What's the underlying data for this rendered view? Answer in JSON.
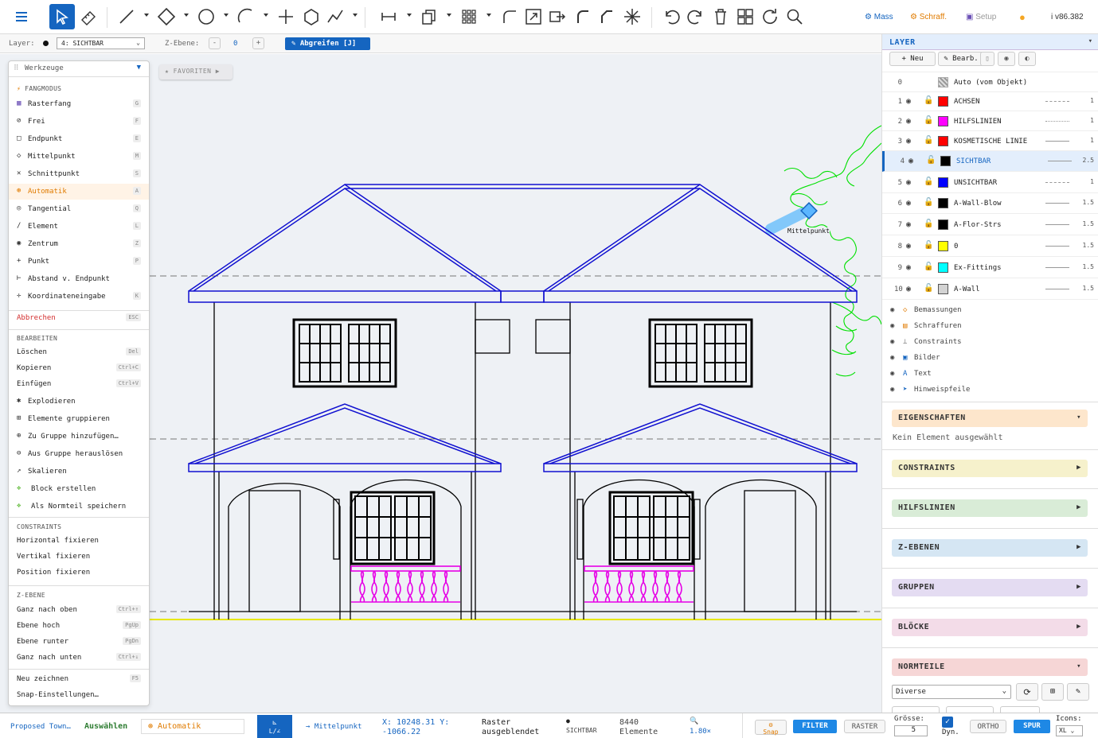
{
  "toolbar": {
    "right": {
      "mass": "Mass",
      "schraff": "Schraff.",
      "setup": "Setup",
      "version": "i v86.382"
    },
    "icons": [
      "menu-icon",
      "select-icon",
      "measure-icon",
      "line-icon",
      "rect-icon",
      "circle-icon",
      "arc-icon",
      "point-icon",
      "polygon-icon",
      "polyline-icon",
      "dimension-icon",
      "copy-icon",
      "array-icon",
      "fillet-icon",
      "scale-icon",
      "move-icon",
      "arc2-icon",
      "chamfer-icon",
      "explode-icon",
      "undo-icon",
      "redo-icon",
      "delete-icon",
      "grid-icon",
      "refresh-icon",
      "search-icon"
    ]
  },
  "layerbar": {
    "layer_label": "Layer:",
    "layer_value": "4: SICHTBAR",
    "z_label": "Z-Ebene:",
    "z_minus": "-",
    "z_value": "0",
    "z_plus": "+",
    "grab": "Abgreifen [J]"
  },
  "canvas": {
    "favorites": "★ FAVORITEN ▶",
    "snap_tooltip": "Mittelpunkt"
  },
  "tools": {
    "title": "Werkzeuge",
    "snap_header": "FANGMODUS",
    "snap": [
      {
        "label": "Rasterfang",
        "key": "G"
      },
      {
        "label": "Frei",
        "key": "F"
      },
      {
        "label": "Endpunkt",
        "key": "E"
      },
      {
        "label": "Mittelpunkt",
        "key": "M"
      },
      {
        "label": "Schnittpunkt",
        "key": "S"
      },
      {
        "label": "Automatik",
        "key": "A"
      },
      {
        "label": "Tangential",
        "key": "Q"
      },
      {
        "label": "Element",
        "key": "L"
      },
      {
        "label": "Zentrum",
        "key": "Z"
      },
      {
        "label": "Punkt",
        "key": "P"
      },
      {
        "label": "Abstand v. Endpunkt",
        "key": ""
      },
      {
        "label": "Koordinateneingabe",
        "key": "K"
      }
    ],
    "cancel": {
      "label": "Abbrechen",
      "key": "ESC"
    },
    "edit_header": "BEARBEITEN",
    "edit": [
      {
        "label": "Löschen",
        "key": "Del"
      },
      {
        "label": "Kopieren",
        "key": "Ctrl+C"
      },
      {
        "label": "Einfügen",
        "key": "Ctrl+V"
      },
      {
        "label": "Explodieren",
        "key": ""
      },
      {
        "label": "Elemente gruppieren",
        "key": ""
      },
      {
        "label": "Zu Gruppe hinzufügen…",
        "key": ""
      },
      {
        "label": "Aus Gruppe herauslösen",
        "key": ""
      },
      {
        "label": "Skalieren",
        "key": ""
      },
      {
        "label": "Block erstellen",
        "key": ""
      },
      {
        "label": "Als Normteil speichern",
        "key": ""
      }
    ],
    "constraints_header": "CONSTRAINTS",
    "constraints": [
      {
        "label": "Horizontal fixieren"
      },
      {
        "label": "Vertikal fixieren"
      },
      {
        "label": "Position fixieren"
      }
    ],
    "z_header": "Z-EBENE",
    "z": [
      {
        "label": "Ganz nach oben",
        "key": "Ctrl+↑"
      },
      {
        "label": "Ebene hoch",
        "key": "PgUp"
      },
      {
        "label": "Ebene runter",
        "key": "PgDn"
      },
      {
        "label": "Ganz nach unten",
        "key": "Ctrl+↓"
      }
    ],
    "redraw": {
      "label": "Neu zeichnen",
      "key": "F5"
    },
    "snap_settings": "Snap-Einstellungen…"
  },
  "layers": {
    "title": "LAYER",
    "btn_new": "+ Neu",
    "btn_edit": "✎ Bearb.",
    "auto": {
      "num": "0",
      "name": "Auto (vom Objekt)"
    },
    "rows": [
      {
        "num": "1",
        "name": "ACHSEN",
        "color": "#ff0000",
        "w": "1"
      },
      {
        "num": "2",
        "name": "HILFSLINIEN",
        "color": "#ff00ff",
        "w": "1"
      },
      {
        "num": "3",
        "name": "KOSMETISCHE LINIE",
        "color": "#ff0000",
        "w": "1"
      },
      {
        "num": "4",
        "name": "SICHTBAR",
        "color": "#000000",
        "w": "2.5"
      },
      {
        "num": "5",
        "name": "UNSICHTBAR",
        "color": "#0000ff",
        "w": "1"
      },
      {
        "num": "6",
        "name": "A-Wall-Blow",
        "color": "#000000",
        "w": "1.5"
      },
      {
        "num": "7",
        "name": "A-Flor-Strs",
        "color": "#000000",
        "w": "1.5"
      },
      {
        "num": "8",
        "name": "0",
        "color": "#ffff00",
        "w": "1.5"
      },
      {
        "num": "9",
        "name": "Ex-Fittings",
        "color": "#00ffff",
        "w": "1.5"
      },
      {
        "num": "10",
        "name": "A-Wall",
        "color": "#d3d3d3",
        "w": "1.5"
      }
    ],
    "categories": [
      {
        "label": "Bemassungen",
        "icon": "◇"
      },
      {
        "label": "Schraffuren",
        "icon": "▤"
      },
      {
        "label": "Constraints",
        "icon": "⊥"
      },
      {
        "label": "Bilder",
        "icon": "▣"
      },
      {
        "label": "Text",
        "icon": "A"
      },
      {
        "label": "Hinweispfeile",
        "icon": "➤"
      }
    ]
  },
  "panels": {
    "eigenschaften": "EIGENSCHAFTEN",
    "no_selection": "Kein Element ausgewählt",
    "constraints": "CONSTRAINTS",
    "hilfslinien": "HILFSLINIEN",
    "z_ebenen": "Z-EBENEN",
    "gruppen": "GRUPPEN",
    "bloecke": "BLÖCKE",
    "normteile": "NORMTEILE",
    "normteile_select": "Diverse"
  },
  "status": {
    "file": "Proposed Town…",
    "mode": "Auswählen",
    "snap": "Automatik",
    "snap_target": "→ Mittelpunkt",
    "coords": "X: 10248.31 Y: -1066.22",
    "raster": "Raster ausgeblendet",
    "layer": "SICHTBAR",
    "count": "8440 Elemente",
    "zoom": "1.80×",
    "snap_btn": "Snap",
    "filter": "FILTER",
    "raster_btn": "RASTER",
    "groesse_label": "Grösse:",
    "groesse_value": "5",
    "dyn": "Dyn.",
    "ortho": "ORTHO",
    "spur": "SPUR",
    "icons_label": "Icons:",
    "icons_value": "XL"
  }
}
